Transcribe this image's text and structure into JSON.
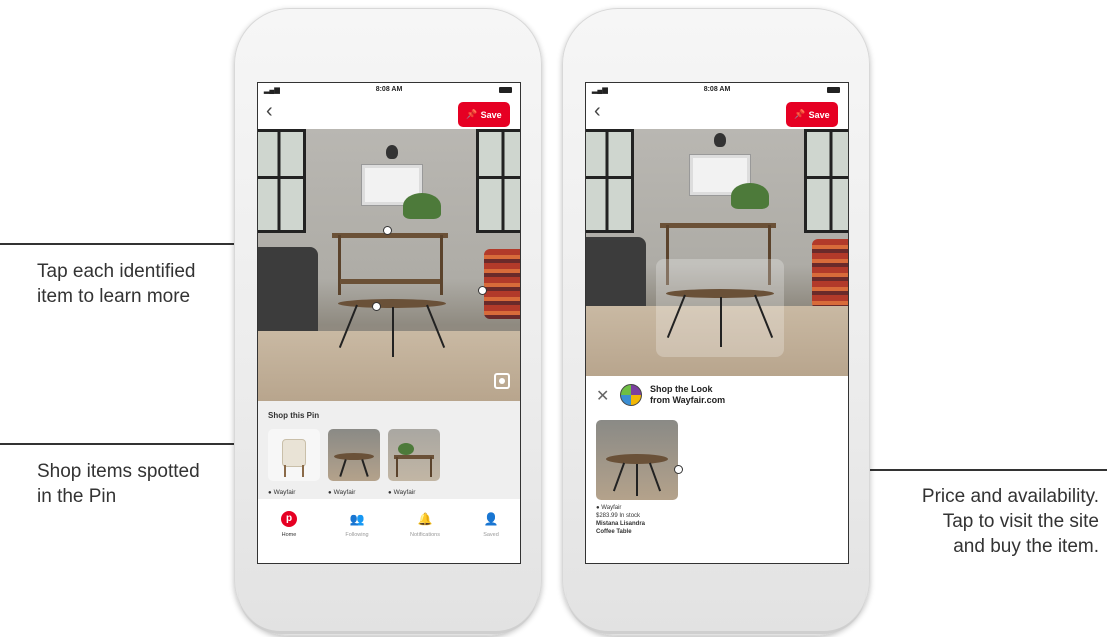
{
  "callouts": {
    "left_top": [
      "Tap each identified",
      "item to learn more"
    ],
    "left_bottom": [
      "Shop items spotted",
      "in the Pin"
    ],
    "right": [
      "Price and availability.",
      "Tap to visit the site",
      "and buy the item."
    ]
  },
  "phone_left": {
    "status_time": "8:08 AM",
    "save_label": "Save",
    "shop_title": "Shop this Pin",
    "thumbs": [
      {
        "label": "Wayfair"
      },
      {
        "label": "Wayfair"
      },
      {
        "label": "Wayfair"
      }
    ],
    "tabs": [
      {
        "label": "Home",
        "icon": "pinterest-logo-icon"
      },
      {
        "label": "Following",
        "icon": "people-icon"
      },
      {
        "label": "Notifications",
        "icon": "bell-icon"
      },
      {
        "label": "Saved",
        "icon": "person-icon"
      }
    ]
  },
  "phone_right": {
    "status_time": "8:08 AM",
    "save_label": "Save",
    "stl_title_line1": "Shop the Look",
    "stl_title_line2": "from Wayfair.com",
    "product": {
      "source": "Wayfair",
      "price": "$283.99",
      "stock": "In stock",
      "name_line1": "Mistana Lisandra",
      "name_line2": "Coffee Table"
    }
  },
  "colors": {
    "pinterest_red": "#e60023",
    "panel_gray": "#efefef"
  }
}
